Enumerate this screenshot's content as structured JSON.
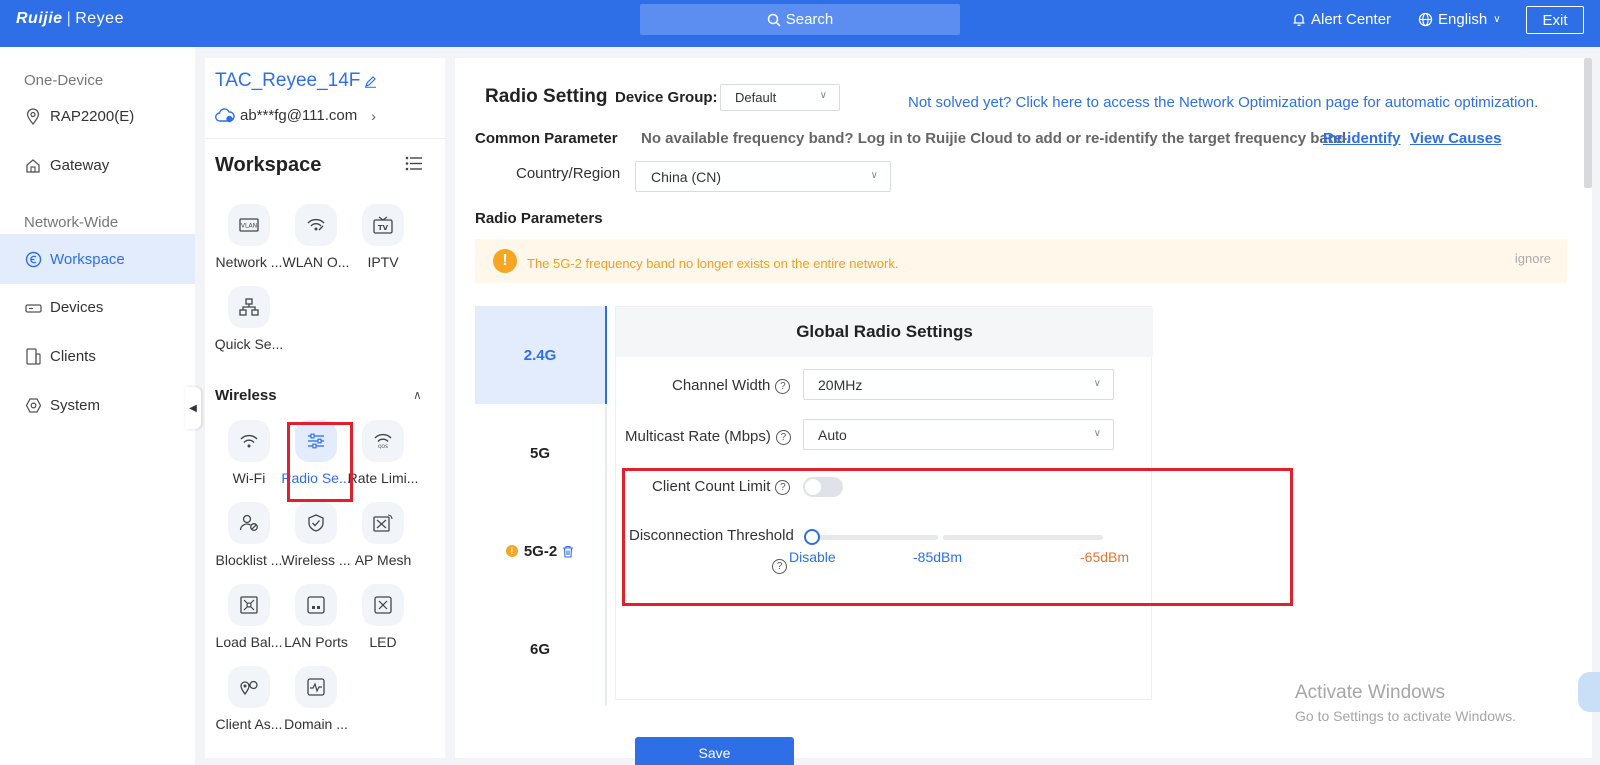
{
  "topbar": {
    "logo_left": "Ruijie",
    "logo_sep": "|",
    "logo_right": "Reyee",
    "search_label": "Search",
    "alert_label": "Alert Center",
    "lang_label": "English",
    "exit_label": "Exit",
    "bg_color": "#2e6fe8"
  },
  "leftnav": {
    "section1": "One-Device",
    "item_device": "RAP2200(E)",
    "item_gateway": "Gateway",
    "section2": "Network-Wide",
    "item_workspace": "Workspace",
    "item_devices": "Devices",
    "item_clients": "Clients",
    "item_system": "System"
  },
  "workspace_panel": {
    "device_title": "TAC_Reyee_14F",
    "account": "ab***fg@111.com",
    "heading": "Workspace",
    "tiles_top": [
      {
        "label": "Network ...",
        "icon": "vlan-icon"
      },
      {
        "label": "WLAN O...",
        "icon": "wlan-optimize-icon"
      },
      {
        "label": "IPTV",
        "icon": "tv-icon"
      },
      {
        "label": "Quick Se...",
        "icon": "network-topology-icon"
      }
    ],
    "wireless_heading": "Wireless",
    "tiles_wireless": [
      {
        "label": "Wi-Fi",
        "icon": "wifi-icon"
      },
      {
        "label": "Radio Se...",
        "icon": "sliders-icon"
      },
      {
        "label": "Rate Limi...",
        "icon": "rate-limit-icon"
      },
      {
        "label": "Blocklist ...",
        "icon": "user-block-icon"
      },
      {
        "label": "Wireless ...",
        "icon": "shield-icon"
      },
      {
        "label": "AP Mesh",
        "icon": "mesh-icon"
      },
      {
        "label": "Load Bal...",
        "icon": "load-balance-icon"
      },
      {
        "label": "LAN Ports",
        "icon": "lan-port-icon"
      },
      {
        "label": "LED",
        "icon": "led-icon"
      },
      {
        "label": "Client As...",
        "icon": "client-assoc-icon"
      },
      {
        "label": "Domain ...",
        "icon": "domain-icon"
      }
    ]
  },
  "main": {
    "title": "Radio Setting",
    "device_group_label": "Device Group:",
    "device_group_value": "Default",
    "not_solved_link": "Not solved yet? Click here to access the Network Optimization page for automatic optimization.",
    "common_param_label": "Common Parameter",
    "common_param_note": "No available frequency band? Log in to Ruijie Cloud to add or re-identify the target frequency band.",
    "reidentify_link": "Re-identify",
    "view_causes_link": "View Causes",
    "country_label": "Country/Region",
    "country_value": "China (CN)",
    "radio_params_label": "Radio Parameters",
    "warning_text": "The 5G-2 frequency band no longer exists on the entire network.",
    "ignore_label": "ignore",
    "bands": [
      "2.4G",
      "5G",
      "5G-2",
      "6G"
    ],
    "card_title": "Global Radio Settings",
    "channel_width_label": "Channel Width",
    "channel_width_value": "20MHz",
    "multicast_label": "Multicast Rate (Mbps)",
    "multicast_value": "Auto",
    "client_limit_label": "Client Count Limit",
    "client_limit_on": false,
    "disconnect_label": "Disconnection Threshold",
    "slider_marks": [
      "Disable",
      "-85dBm",
      "-65dBm"
    ],
    "slider_value": "Disable",
    "save_label": "Save"
  },
  "watermark": {
    "line1": "Activate Windows",
    "line2": "Go to Settings to activate Windows."
  },
  "colors": {
    "accent": "#2e6fe8",
    "warning": "#f5a623",
    "highlight_box": "#e0202c",
    "mark_orange": "#e8742a"
  }
}
